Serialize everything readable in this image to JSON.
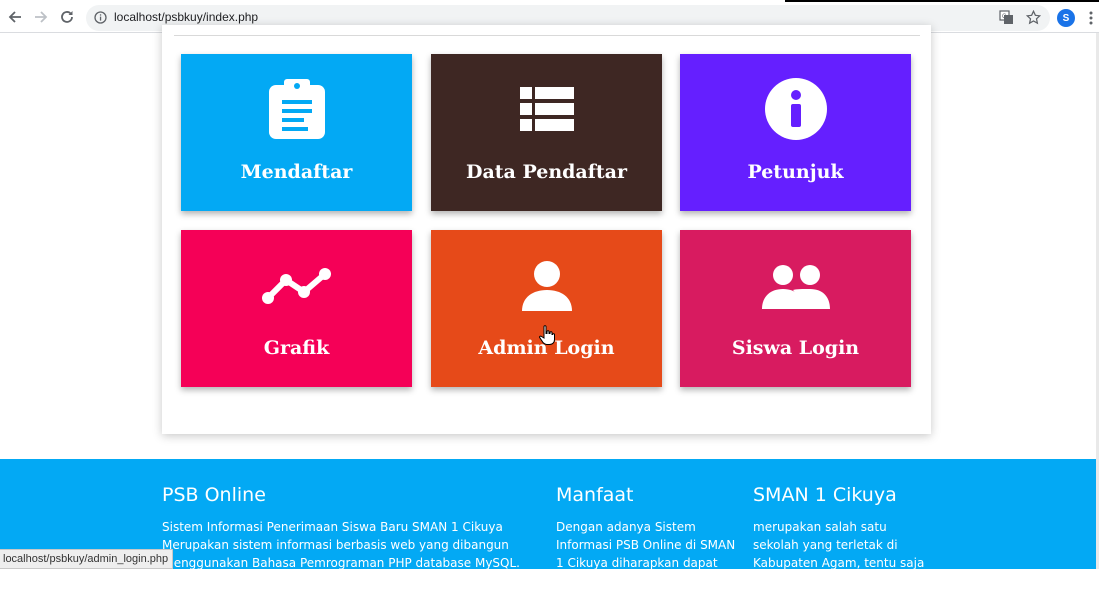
{
  "browser": {
    "url": "localhost/psbkuy/index.php"
  },
  "tiles": [
    {
      "label": "Mendaftar",
      "icon": "clipboard-icon",
      "color": "#03a9f4"
    },
    {
      "label": "Data Pendaftar",
      "icon": "table-list-icon",
      "color": "#3e2723"
    },
    {
      "label": "Petunjuk",
      "icon": "info-circle-icon",
      "color": "#651fff"
    },
    {
      "label": "Grafik",
      "icon": "line-chart-icon",
      "color": "#f50057"
    },
    {
      "label": "Admin Login",
      "icon": "user-icon",
      "color": "#e64a19"
    },
    {
      "label": "Siswa Login",
      "icon": "users-icon",
      "color": "#d81b60"
    }
  ],
  "footer": {
    "color": "#03a9f4",
    "col1": {
      "title": "PSB Online",
      "text": "Sistem Informasi Penerimaan Siswa Baru SMAN 1 Cikuya Merupakan sistem informasi berbasis web yang dibangun menggunakan Bahasa Pemrograman PHP database MySQL. Sedangkan Front End dari"
    },
    "col2": {
      "title": "Manfaat",
      "text": "Dengan adanya Sistem Informasi PSB Online di SMAN 1 Cikuya diharapkan dapat"
    },
    "col3": {
      "title": "SMAN 1 Cikuya",
      "text": "merupakan salah satu sekolah yang terletak di Kabupaten Agam, tentu saja sekolah ini"
    }
  },
  "status_bar": {
    "text": "localhost/psbkuy/admin_login.php"
  }
}
